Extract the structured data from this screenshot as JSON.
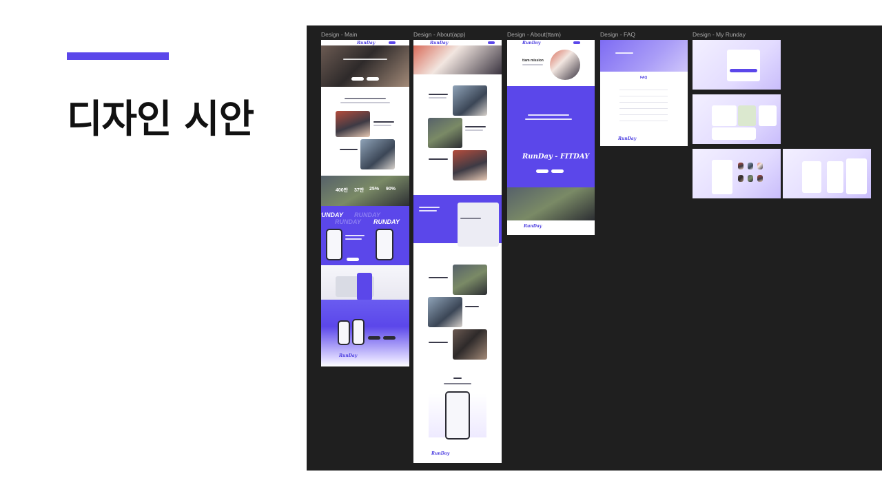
{
  "slide": {
    "title": "디자인 시안",
    "accent_color": "#5b47ea"
  },
  "canvas": {
    "background": "#1f1f1f",
    "frames": [
      {
        "label": "Design - Main"
      },
      {
        "label": "Design - About(app)"
      },
      {
        "label": "Design - About(ttam)"
      },
      {
        "label": "Design - FAQ"
      },
      {
        "label": "Design - My Runday"
      }
    ]
  },
  "mockup": {
    "logo": "RunDay",
    "stats": [
      "400만",
      "37만",
      "25%",
      "90%"
    ],
    "marquee": "RUNDAY",
    "fitday": "FITDAY",
    "main_tagline": "Runday, It's More than Exercise",
    "ttam_heading": "ttam mission",
    "faq_heading": "FAQ"
  }
}
